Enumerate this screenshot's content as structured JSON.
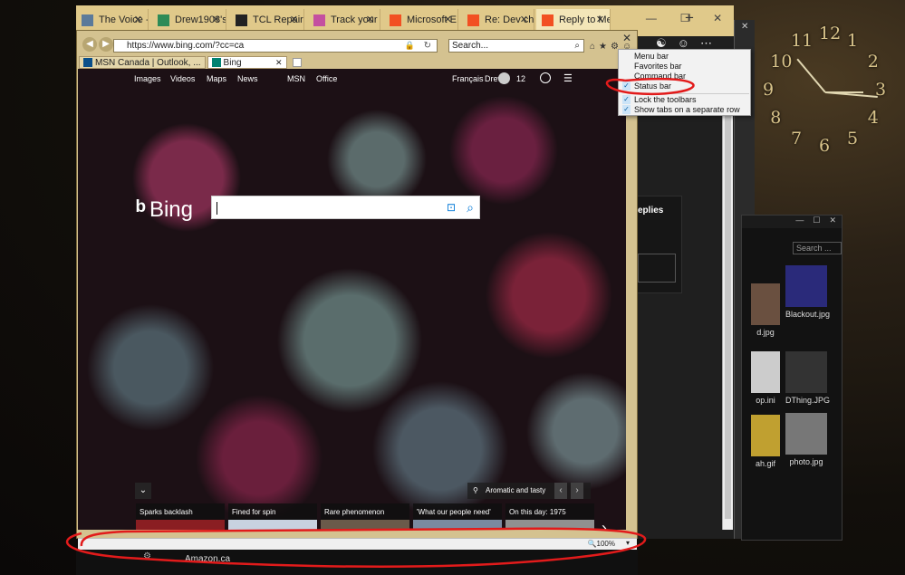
{
  "edge": {
    "tabs": [
      {
        "label": "The Voice -",
        "fav_color": "#5b7a9a"
      },
      {
        "label": "Drew1903's",
        "fav_color": "#2e8b57"
      },
      {
        "label": "TCL Repair",
        "fav_color": "#222222"
      },
      {
        "label": "Track your",
        "fav_color": "#c44fa0"
      },
      {
        "label": "Microsoft E",
        "fav_color": "#f25022"
      },
      {
        "label": "Re: Dev cha",
        "fav_color": "#f25022"
      },
      {
        "label": "Reply to Me",
        "fav_color": "#f25022"
      }
    ],
    "new_tab": "+",
    "window_controls": [
      "—",
      "☐",
      "✕"
    ],
    "top_icons": [
      "☯",
      "☺",
      "⋯"
    ],
    "page_fragment": "eplies"
  },
  "ie": {
    "url": "https://www.bing.com/?cc=ca",
    "search_placeholder": "Search...",
    "tabs": [
      {
        "label": "MSN Canada | Outlook, ..."
      },
      {
        "label": "Bing"
      }
    ],
    "tools": [
      "⌂",
      "★",
      "⚙",
      "☺"
    ],
    "close": "✕"
  },
  "bing": {
    "nav": [
      "Images",
      "Videos",
      "Maps",
      "News",
      "MSN",
      "Office"
    ],
    "lang": "Français",
    "user": "Drew",
    "rewards": "12",
    "logo": "Bing",
    "image_info": "Aromatic and tasty",
    "cards": [
      {
        "title": "Sparks backlash",
        "color": "#8a1e22"
      },
      {
        "title": "Fined for spin",
        "color": "#c8d2e0"
      },
      {
        "title": "Rare phenomenon",
        "color": "#6a5a4a"
      },
      {
        "title": "'What our people need'",
        "color": "#7a8aa0"
      },
      {
        "title": "On this day: 1975",
        "color": "#909090"
      }
    ]
  },
  "context_menu": {
    "items": [
      {
        "label": "Menu bar",
        "checked": false
      },
      {
        "label": "Favorites bar",
        "checked": false
      },
      {
        "label": "Command bar",
        "checked": false
      },
      {
        "label": "Status bar",
        "checked": true
      },
      {
        "label": "Lock the toolbars",
        "checked": true
      },
      {
        "label": "Show tabs on a separate row",
        "checked": true
      }
    ]
  },
  "status_bar": {
    "zoom": "100%"
  },
  "under": {
    "text": "Amazon.ca"
  },
  "explorer": {
    "search": "Search ...",
    "files": [
      {
        "name": "d.jpg",
        "color": "#6a5040"
      },
      {
        "name": "Blackout.jpg",
        "color": "#2a2a7a"
      },
      {
        "name": "op.ini",
        "color": "#cccccc"
      },
      {
        "name": "DThing.JPG",
        "color": "#333333"
      },
      {
        "name": "ah.gif",
        "color": "#c0a030"
      },
      {
        "name": "photo.jpg",
        "color": "#777777"
      }
    ]
  },
  "clock": {
    "numbers": [
      "12",
      "1",
      "2",
      "3",
      "4",
      "5",
      "6",
      "7",
      "8",
      "9",
      "10",
      "11"
    ]
  }
}
